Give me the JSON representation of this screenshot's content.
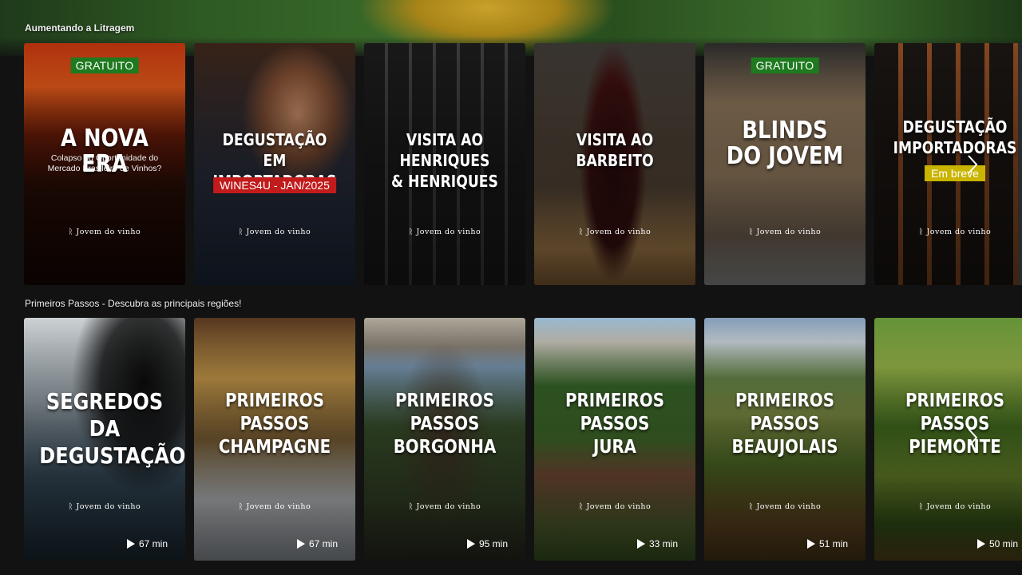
{
  "rows": [
    {
      "title": "Aumentando a Litragem",
      "cards": [
        {
          "badge": "GRATUITO",
          "title": "A NOVA ERA",
          "subtitle": "Colapso ou Oportunidade do\nMercado Brasileiro de Vinhos?",
          "tag": "",
          "brand": "Jovem do vinho",
          "bg": "fire"
        },
        {
          "badge": "",
          "title": "DEGUSTAÇÃO EM\nIMPORTADORAS",
          "subtitle": "",
          "tag": "WINES4U - JAN/2025",
          "brand": "Jovem do vinho",
          "bg": "man"
        },
        {
          "badge": "",
          "title": "VISITA AO\nHENRIQUES\n& HENRIQUES",
          "subtitle": "",
          "tag": "",
          "brand": "Jovem do vinho",
          "bg": "bottles"
        },
        {
          "badge": "",
          "title": "VISITA AO\nBARBEITO",
          "subtitle": "",
          "tag": "",
          "brand": "Jovem do vinho",
          "bg": "bottle"
        },
        {
          "badge": "GRATUITO",
          "title": "BLINDS\nDO JOVEM",
          "subtitle": "",
          "tag": "",
          "brand": "Jovem do vinho",
          "bg": "bags"
        },
        {
          "badge": "",
          "title": "DEGUSTAÇÃO\nIMPORTADORAS",
          "subtitle": "",
          "tag": "Em breve",
          "brand": "Jovem do vinho",
          "bg": "crate"
        }
      ]
    },
    {
      "title": "Primeiros Passos - Descubra as principais regiões!",
      "cards": [
        {
          "title": "SEGREDOS DA\nDEGUSTAÇÃO",
          "brand": "Jovem do vinho",
          "duration": "67 min",
          "bg": "glass"
        },
        {
          "title": "PRIMEIROS PASSOS\nCHAMPAGNE",
          "brand": "Jovem do vinho",
          "duration": "67 min",
          "bg": "champagne"
        },
        {
          "title": "PRIMEIROS PASSOS\nBORGONHA",
          "brand": "Jovem do vinho",
          "duration": "95 min",
          "bg": "borgonha"
        },
        {
          "title": "PRIMEIROS PASSOS\nJURA",
          "brand": "Jovem do vinho",
          "duration": "33 min",
          "bg": "jura"
        },
        {
          "title": "PRIMEIROS PASSOS\nBEAUJOLAIS",
          "brand": "Jovem do vinho",
          "duration": "51 min",
          "bg": "beaujolais"
        },
        {
          "title": "PRIMEIROS PASSOS\nPIEMONTE",
          "brand": "Jovem do vinho",
          "duration": "50 min",
          "bg": "piemonte"
        }
      ]
    }
  ],
  "icons": {
    "next": "chevron-right-icon",
    "play": "play-icon",
    "brand": "grape-logo-icon"
  },
  "colors": {
    "badge": "#1f7a1f",
    "tag_red": "#c11b1b",
    "tag_yellow": "#c9b400",
    "background": "#121212"
  }
}
